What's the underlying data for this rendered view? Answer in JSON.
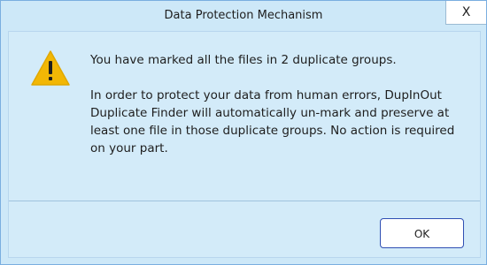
{
  "window": {
    "title": "Data Protection Mechanism",
    "close_label": "X"
  },
  "icons": {
    "warning": "warning-icon",
    "accent_color": "#f2b705"
  },
  "message": {
    "line1": "You have marked all the files in 2 duplicate groups.",
    "line2": "In order to protect your data from human errors, DupInOut Duplicate Finder will automatically un-mark and preserve at least one file in those duplicate groups. No action is required on your part."
  },
  "buttons": {
    "ok_label": "OK"
  }
}
